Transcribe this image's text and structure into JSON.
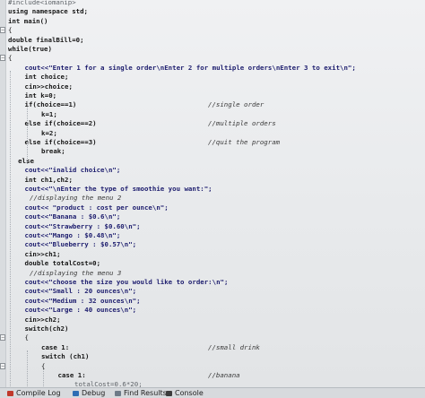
{
  "editor": {
    "lines": [
      {
        "text": "#include<iomanip>",
        "cls": "dim",
        "indent": 0
      },
      {
        "text": "using namespace std;",
        "cls": "kw",
        "indent": 0
      },
      {
        "text": "int main()",
        "cls": "kw",
        "indent": 0
      },
      {
        "text": "{",
        "cls": "",
        "indent": 0
      },
      {
        "text": "double finalBill=0;",
        "cls": "kw",
        "indent": 0
      },
      {
        "text": "while(true)",
        "cls": "kw",
        "indent": 0
      },
      {
        "text": "{",
        "cls": "",
        "indent": 0
      },
      {
        "text": "cout<<\"Enter 1 for a single order\\nEnter 2 for multiple orders\\nEnter 3 to exit\\n\";",
        "cls": "str",
        "indent": 1
      },
      {
        "text": "int choice;",
        "cls": "kw",
        "indent": 1
      },
      {
        "text": "cin>>choice;",
        "cls": "kw",
        "indent": 1
      },
      {
        "text": "int k=0;",
        "cls": "kw",
        "indent": 1
      },
      {
        "text": "if(choice==1)",
        "cls": "kw",
        "indent": 1,
        "comment": "//single order"
      },
      {
        "text": "k=1;",
        "cls": "kw",
        "indent": 2
      },
      {
        "text": "else if(choice==2)",
        "cls": "kw",
        "indent": 1,
        "comment": "//multiple orders"
      },
      {
        "text": "k=2;",
        "cls": "kw",
        "indent": 2
      },
      {
        "text": "else if(choice==3)",
        "cls": "kw",
        "indent": 1,
        "comment": "//quit the program"
      },
      {
        "text": "break;",
        "cls": "kw",
        "indent": 2
      },
      {
        "text": "else",
        "cls": "kw",
        "indent": 0.6
      },
      {
        "text": "cout<<\"inalid choice\\n\";",
        "cls": "str",
        "indent": 1
      },
      {
        "text": "int ch1,ch2;",
        "cls": "kw",
        "indent": 1
      },
      {
        "text": "cout<<\"\\nEnter the type of smoothie you want:\";",
        "cls": "str",
        "indent": 1
      },
      {
        "text": "//displaying the menu 2",
        "cls": "com",
        "indent": 1.3
      },
      {
        "text": "cout<< \"product : cost per ounce\\n\";",
        "cls": "str",
        "indent": 1
      },
      {
        "text": "cout<<\"Banana : $0.6\\n\";",
        "cls": "str",
        "indent": 1
      },
      {
        "text": "cout<<\"Strawberry : $0.60\\n\";",
        "cls": "str",
        "indent": 1
      },
      {
        "text": "cout<<\"Mango : $0.48\\n\";",
        "cls": "str",
        "indent": 1
      },
      {
        "text": "cout<<\"Blueberry : $0.57\\n\";",
        "cls": "str",
        "indent": 1
      },
      {
        "text": "cin>>ch1;",
        "cls": "kw",
        "indent": 1
      },
      {
        "text": "double totalCost=0;",
        "cls": "kw",
        "indent": 1
      },
      {
        "text": "//displaying the menu 3",
        "cls": "com",
        "indent": 1.3
      },
      {
        "text": "cout<<\"choose the size you would like to order:\\n\";",
        "cls": "str",
        "indent": 1
      },
      {
        "text": "cout<<\"Small : 20 ounces\\n\";",
        "cls": "str",
        "indent": 1
      },
      {
        "text": "cout<<\"Medium : 32 ounces\\n\";",
        "cls": "str",
        "indent": 1
      },
      {
        "text": "cout<<\"Large : 40 ounces\\n\";",
        "cls": "str",
        "indent": 1
      },
      {
        "text": "cin>>ch2;",
        "cls": "kw",
        "indent": 1
      },
      {
        "text": "switch(ch2)",
        "cls": "kw",
        "indent": 1
      },
      {
        "text": "{",
        "cls": "",
        "indent": 1
      },
      {
        "text": "case 1:",
        "cls": "kw",
        "indent": 2,
        "comment": "//small drink"
      },
      {
        "text": "switch (ch1)",
        "cls": "kw",
        "indent": 2
      },
      {
        "text": "{",
        "cls": "",
        "indent": 2
      },
      {
        "text": "case 1:",
        "cls": "kw",
        "indent": 3,
        "comment": "//banana"
      },
      {
        "text": "totalCost=0.6*20;",
        "cls": "dim",
        "indent": 4
      }
    ]
  },
  "bottom_tabs": [
    {
      "label": "Compile Log",
      "icon": "compile-log-icon",
      "color": "#c0392b"
    },
    {
      "label": "Debug",
      "icon": "debug-icon",
      "color": "#2e6db4"
    },
    {
      "label": "Find Results",
      "icon": "find-results-icon",
      "color": "#6d7a87"
    },
    {
      "label": "Console",
      "icon": "console-icon",
      "color": "#3c3c3c"
    }
  ]
}
